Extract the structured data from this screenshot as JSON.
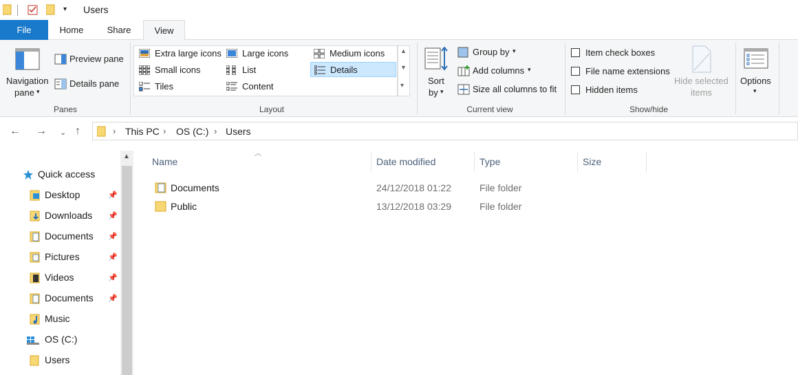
{
  "window": {
    "title": "Users"
  },
  "ribbon_tabs": [
    "File",
    "Home",
    "Share",
    "View"
  ],
  "panes": {
    "navigation_pane_line1": "Navigation",
    "navigation_pane_line2": "pane",
    "preview_pane": "Preview pane",
    "details_pane": "Details pane",
    "group_label": "Panes"
  },
  "layout": {
    "extra_large_icons": "Extra large icons",
    "large_icons": "Large icons",
    "medium_icons": "Medium icons",
    "small_icons": "Small icons",
    "list": "List",
    "details": "Details",
    "tiles": "Tiles",
    "content": "Content",
    "group_label": "Layout",
    "selected": "Details"
  },
  "current_view": {
    "sort_line1": "Sort",
    "sort_line2": "by",
    "group_by": "Group by",
    "add_columns": "Add columns",
    "size_all_columns": "Size all columns to fit",
    "group_label": "Current view"
  },
  "show_hide": {
    "item_check_boxes": "Item check boxes",
    "file_name_extensions": "File name extensions",
    "hidden_items": "Hidden items",
    "hide_selected_line1": "Hide selected",
    "hide_selected_line2": "items",
    "group_label": "Show/hide"
  },
  "options": {
    "label": "Options"
  },
  "breadcrumb": [
    "This PC",
    "OS (C:)",
    "Users"
  ],
  "nav_pane": {
    "items": [
      {
        "label": "Quick access",
        "icon": "star-icon",
        "pinned": false
      },
      {
        "label": "Desktop",
        "icon": "desktop-folder-icon",
        "pinned": true
      },
      {
        "label": "Downloads",
        "icon": "downloads-folder-icon",
        "pinned": true
      },
      {
        "label": "Documents",
        "icon": "documents-folder-icon",
        "pinned": true
      },
      {
        "label": "Pictures",
        "icon": "pictures-folder-icon",
        "pinned": true
      },
      {
        "label": "Videos",
        "icon": "videos-folder-icon",
        "pinned": true
      },
      {
        "label": "Documents",
        "icon": "documents-folder-icon",
        "pinned": true
      },
      {
        "label": "Music",
        "icon": "music-folder-icon",
        "pinned": false
      },
      {
        "label": "OS (C:)",
        "icon": "drive-icon",
        "pinned": false
      },
      {
        "label": "Users",
        "icon": "folder-icon",
        "pinned": false
      }
    ]
  },
  "file_list": {
    "columns": [
      "Name",
      "Date modified",
      "Type",
      "Size"
    ],
    "rows": [
      {
        "name": "Documents",
        "date": "24/12/2018 01:22",
        "type": "File folder",
        "size": ""
      },
      {
        "name": "Public",
        "date": "13/12/2018 03:29",
        "type": "File folder",
        "size": ""
      }
    ]
  },
  "colors": {
    "accent": "#1979ca",
    "folder": "#f8d775",
    "selection": "#cce8ff"
  }
}
